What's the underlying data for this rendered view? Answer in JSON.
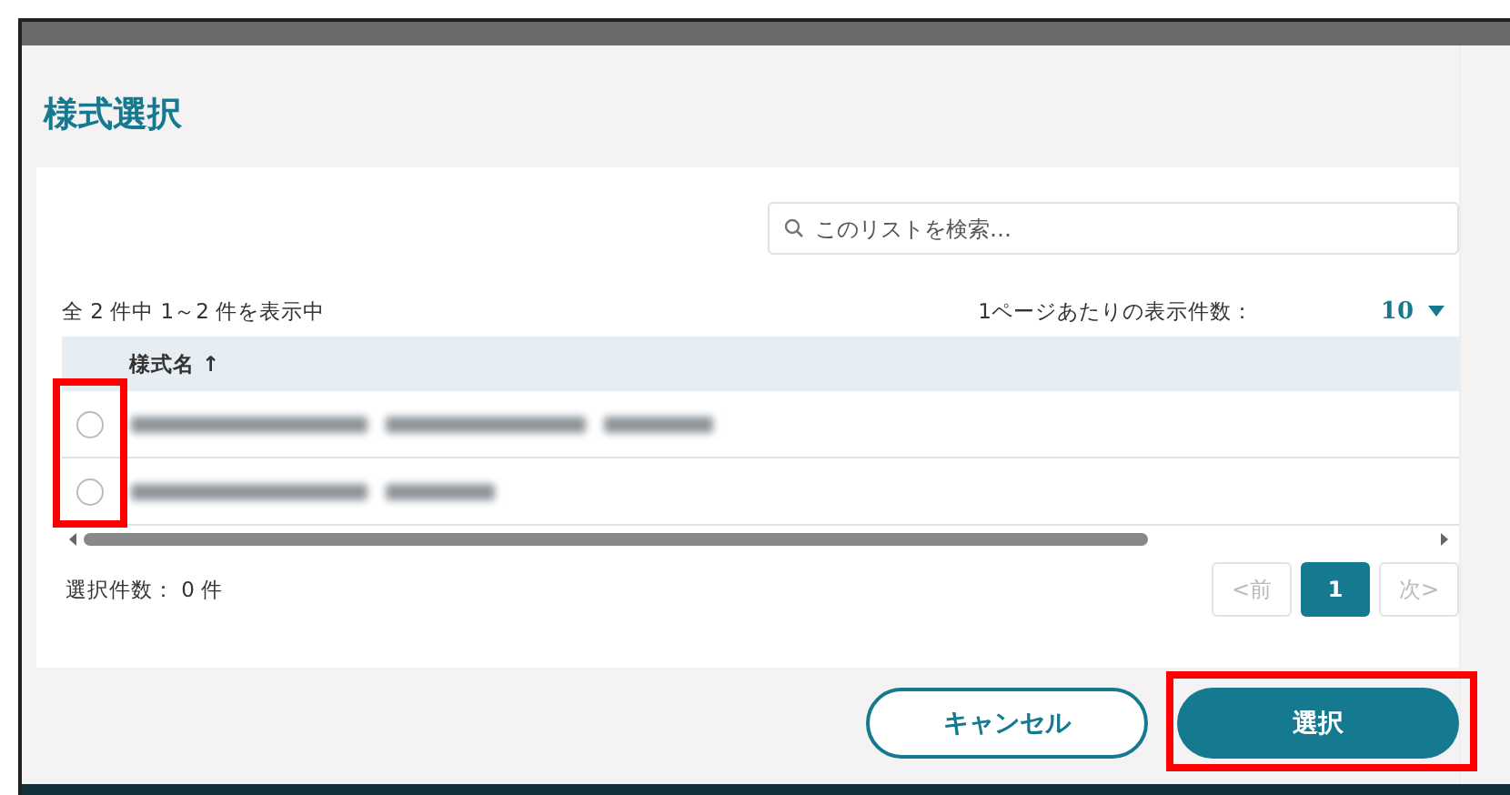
{
  "dialog": {
    "title": "様式選択"
  },
  "search": {
    "placeholder": "このリストを検索…"
  },
  "summary": "全 2 件中 1～2 件を表示中",
  "page_size": {
    "label": "1ページあたりの表示件数：",
    "value": "10"
  },
  "table": {
    "radio_column_highlighted": true,
    "columns": [
      {
        "label": "様式名",
        "sort_indicator": "↑"
      }
    ],
    "rows": [
      {
        "selected": false,
        "kind": "blurred"
      },
      {
        "selected": false,
        "kind": "blurred"
      }
    ]
  },
  "selection_count": "選択件数： 0 件",
  "pagination": {
    "prev": {
      "label": "<前",
      "disabled": true
    },
    "pages": [
      {
        "label": "1",
        "selected": true
      }
    ],
    "next": {
      "label": "次>",
      "disabled": true
    }
  },
  "buttons": [
    {
      "label": "キャンセル",
      "kind": "secondary",
      "highlighted": false
    },
    {
      "label": "選択",
      "kind": "primary",
      "highlighted": true
    }
  ]
}
